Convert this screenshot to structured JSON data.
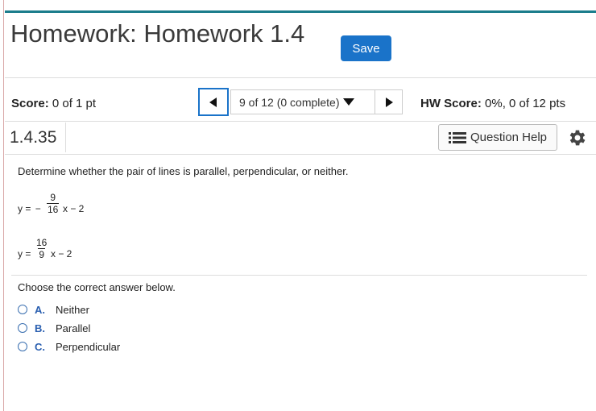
{
  "header": {
    "title": "Homework: Homework 1.4",
    "save_label": "Save"
  },
  "nav": {
    "score_label": "Score:",
    "score_value": "0 of 1 pt",
    "position": "9 of 12 (0 complete)",
    "hw_label": "HW Score:",
    "hw_value": "0%, 0 of 12 pts"
  },
  "question": {
    "number": "1.4.35",
    "help_label": "Question Help",
    "prompt": "Determine whether the pair of lines is parallel, perpendicular, or neither.",
    "eq1": {
      "y": "y =",
      "sign": "−",
      "num": "9",
      "den": "16",
      "rest": "x − 2"
    },
    "eq2": {
      "y": "y =",
      "num": "16",
      "den": "9",
      "rest": "x − 2"
    },
    "choose": "Choose the correct answer below.",
    "options": [
      {
        "letter": "A.",
        "text": "Neither"
      },
      {
        "letter": "B.",
        "text": "Parallel"
      },
      {
        "letter": "C.",
        "text": "Perpendicular"
      }
    ]
  }
}
